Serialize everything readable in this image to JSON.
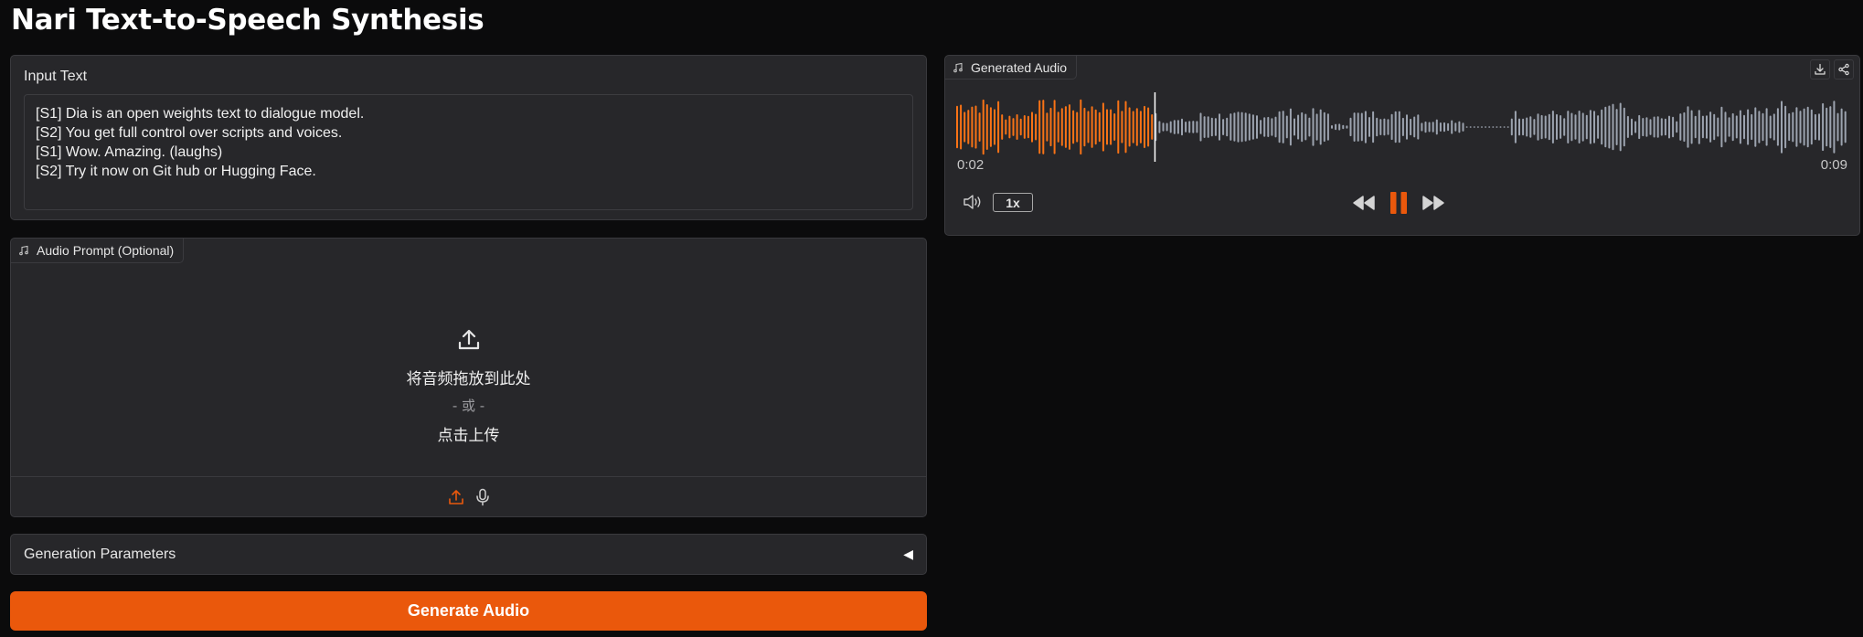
{
  "page": {
    "title": "Nari Text-to-Speech Synthesis"
  },
  "input": {
    "label": "Input Text",
    "value": "[S1] Dia is an open weights text to dialogue model.\n[S2] You get full control over scripts and voices.\n[S1] Wow. Amazing. (laughs)\n[S2] Try it now on Git hub or Hugging Face."
  },
  "audio_prompt": {
    "label": "Audio Prompt (Optional)",
    "drop_text": "将音频拖放到此处",
    "or_text": "- 或 -",
    "click_text": "点击上传",
    "icons": {
      "label": "music-note-icon",
      "upload": "upload-icon",
      "source_upload": "upload-source-icon",
      "source_mic": "microphone-icon"
    }
  },
  "params": {
    "label": "Generation Parameters",
    "caret": "◀"
  },
  "generate": {
    "label": "Generate Audio"
  },
  "output": {
    "label": "Generated Audio",
    "current_time": "0:02",
    "total_time": "0:09",
    "progress": 0.222,
    "speed": "1x",
    "icons": {
      "download": "download-icon",
      "share": "share-icon",
      "volume": "volume-icon",
      "rewind": "rewind-icon",
      "pause": "pause-icon",
      "forward": "fast-forward-icon"
    }
  },
  "colors": {
    "accent": "#ea580c",
    "panel": "#27272a",
    "background": "#0b0b0c",
    "wave_played": "#f97316",
    "wave_unplayed": "#9ca3af"
  }
}
